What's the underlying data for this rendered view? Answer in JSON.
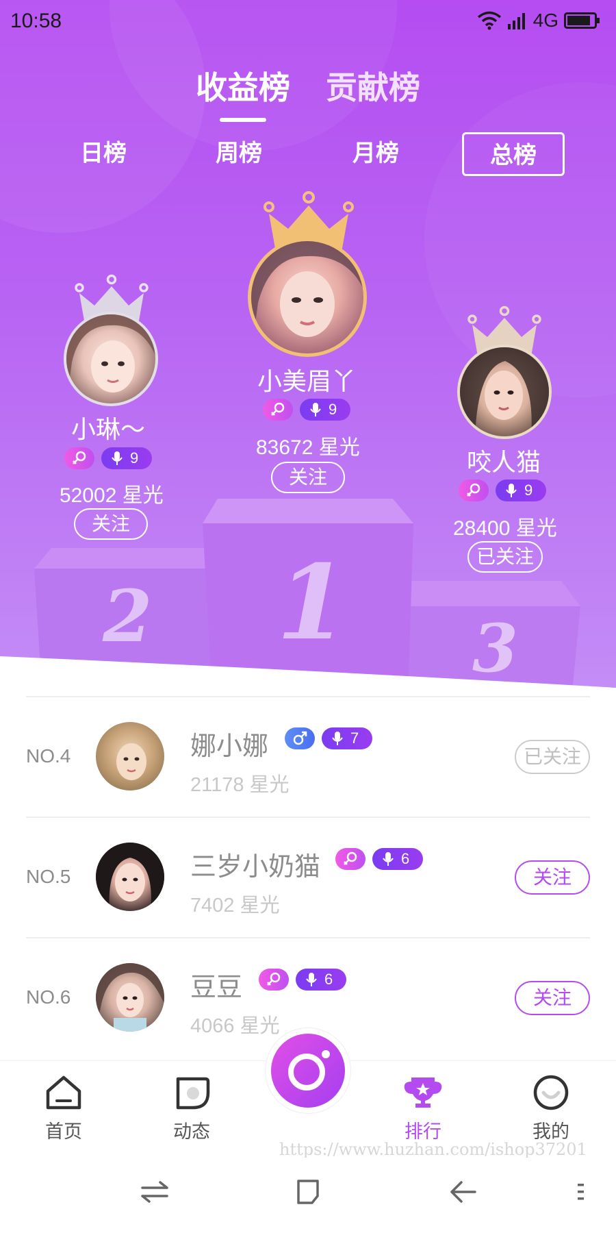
{
  "status_bar": {
    "time": "10:58",
    "network": "4G"
  },
  "main_tabs": [
    {
      "label": "收益榜",
      "active": true
    },
    {
      "label": "贡献榜",
      "active": false
    }
  ],
  "period_tabs": [
    {
      "label": "日榜",
      "active": false
    },
    {
      "label": "周榜",
      "active": false
    },
    {
      "label": "月榜",
      "active": false
    },
    {
      "label": "总榜",
      "active": true
    }
  ],
  "podium": {
    "first": {
      "rank": "1",
      "name": "小美眉丫",
      "gender": "female",
      "level": "9",
      "score": "83672 星光",
      "follow_label": "关注"
    },
    "second": {
      "rank": "2",
      "name": "小琳～",
      "gender": "female",
      "level": "9",
      "score": "52002 星光",
      "follow_label": "关注"
    },
    "third": {
      "rank": "3",
      "name": "咬人猫",
      "gender": "female",
      "level": "9",
      "score": "28400 星光",
      "follow_label": "已关注"
    }
  },
  "list": [
    {
      "rank": "NO.4",
      "name": "娜小娜",
      "gender": "male",
      "level": "7",
      "score": "21178 星光",
      "follow_label": "已关注",
      "followed": true
    },
    {
      "rank": "NO.5",
      "name": "三岁小奶猫",
      "gender": "female",
      "level": "6",
      "score": "7402 星光",
      "follow_label": "关注",
      "followed": false
    },
    {
      "rank": "NO.6",
      "name": "豆豆",
      "gender": "female",
      "level": "6",
      "score": "4066 星光",
      "follow_label": "关注",
      "followed": false
    }
  ],
  "bottom_nav": [
    {
      "label": "首页",
      "icon": "home-icon"
    },
    {
      "label": "动态",
      "icon": "moments-icon"
    },
    {
      "label": "",
      "icon": "camera-icon"
    },
    {
      "label": "排行",
      "icon": "trophy-icon",
      "active": true
    },
    {
      "label": "我的",
      "icon": "profile-icon"
    }
  ],
  "watermark": "https://www.huzhan.com/ishop37201",
  "colors": {
    "accent": "#b34bf0",
    "hero_top": "#b54df2",
    "hero_bottom": "#c48ef6"
  }
}
